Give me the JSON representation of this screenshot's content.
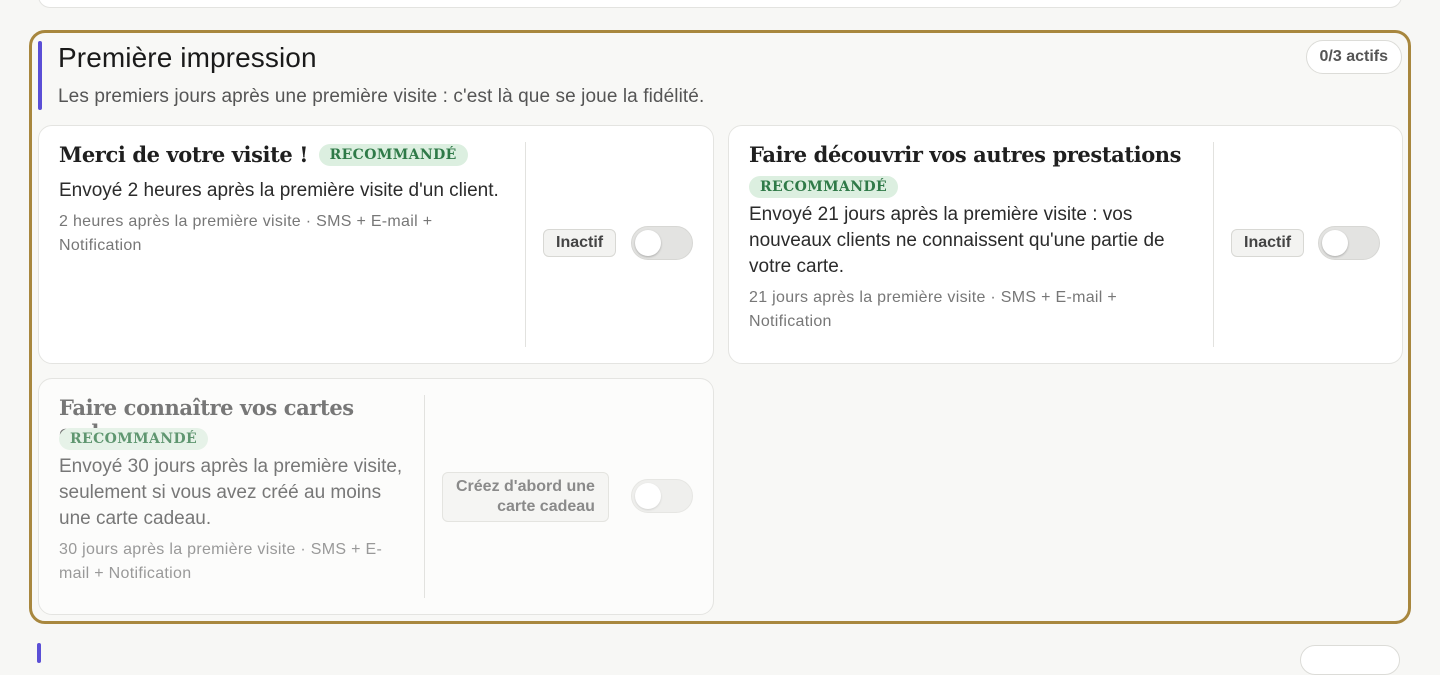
{
  "section": {
    "title": "Première impression",
    "subtitle": "Les premiers jours après une première visite : c'est là que se joue la fidélité.",
    "count_badge": "0/3 actifs",
    "accent_color": "#5b4fd6",
    "highlight_border_color": "#a8873e"
  },
  "cards": [
    {
      "title": "Merci de votre visite !",
      "badge": "RECOMMANDÉ",
      "description": "Envoyé 2 heures après la première visite d'un client.",
      "meta_line1": "2 heures après la première visite · SMS + E-mail +",
      "meta_line2": "Notification",
      "status": "Inactif",
      "enabled": false
    },
    {
      "title": "Faire découvrir vos autres prestations",
      "badge": "RECOMMANDÉ",
      "description_line1": "Envoyé 21 jours après la première visite : vos",
      "description_line2": "nouveaux clients ne connaissent qu'une partie de",
      "description_line3": "votre carte.",
      "meta_line1": "21 jours après la première visite · SMS + E-mail +",
      "meta_line2": "Notification",
      "status": "Inactif",
      "enabled": false
    },
    {
      "title": "Faire connaître vos cartes cadeaux",
      "badge": "RECOMMANDÉ",
      "description_line1": "Envoyé 30 jours après la première visite,",
      "description_line2": "seulement si vous avez créé au moins",
      "description_line3": "une carte cadeau.",
      "meta_line1": "30 jours après la première visite · SMS + E-",
      "meta_line2": "mail + Notification",
      "status_line1": "Créez d'abord une",
      "status_line2": "carte cadeau",
      "enabled": false,
      "disabled": true
    }
  ]
}
